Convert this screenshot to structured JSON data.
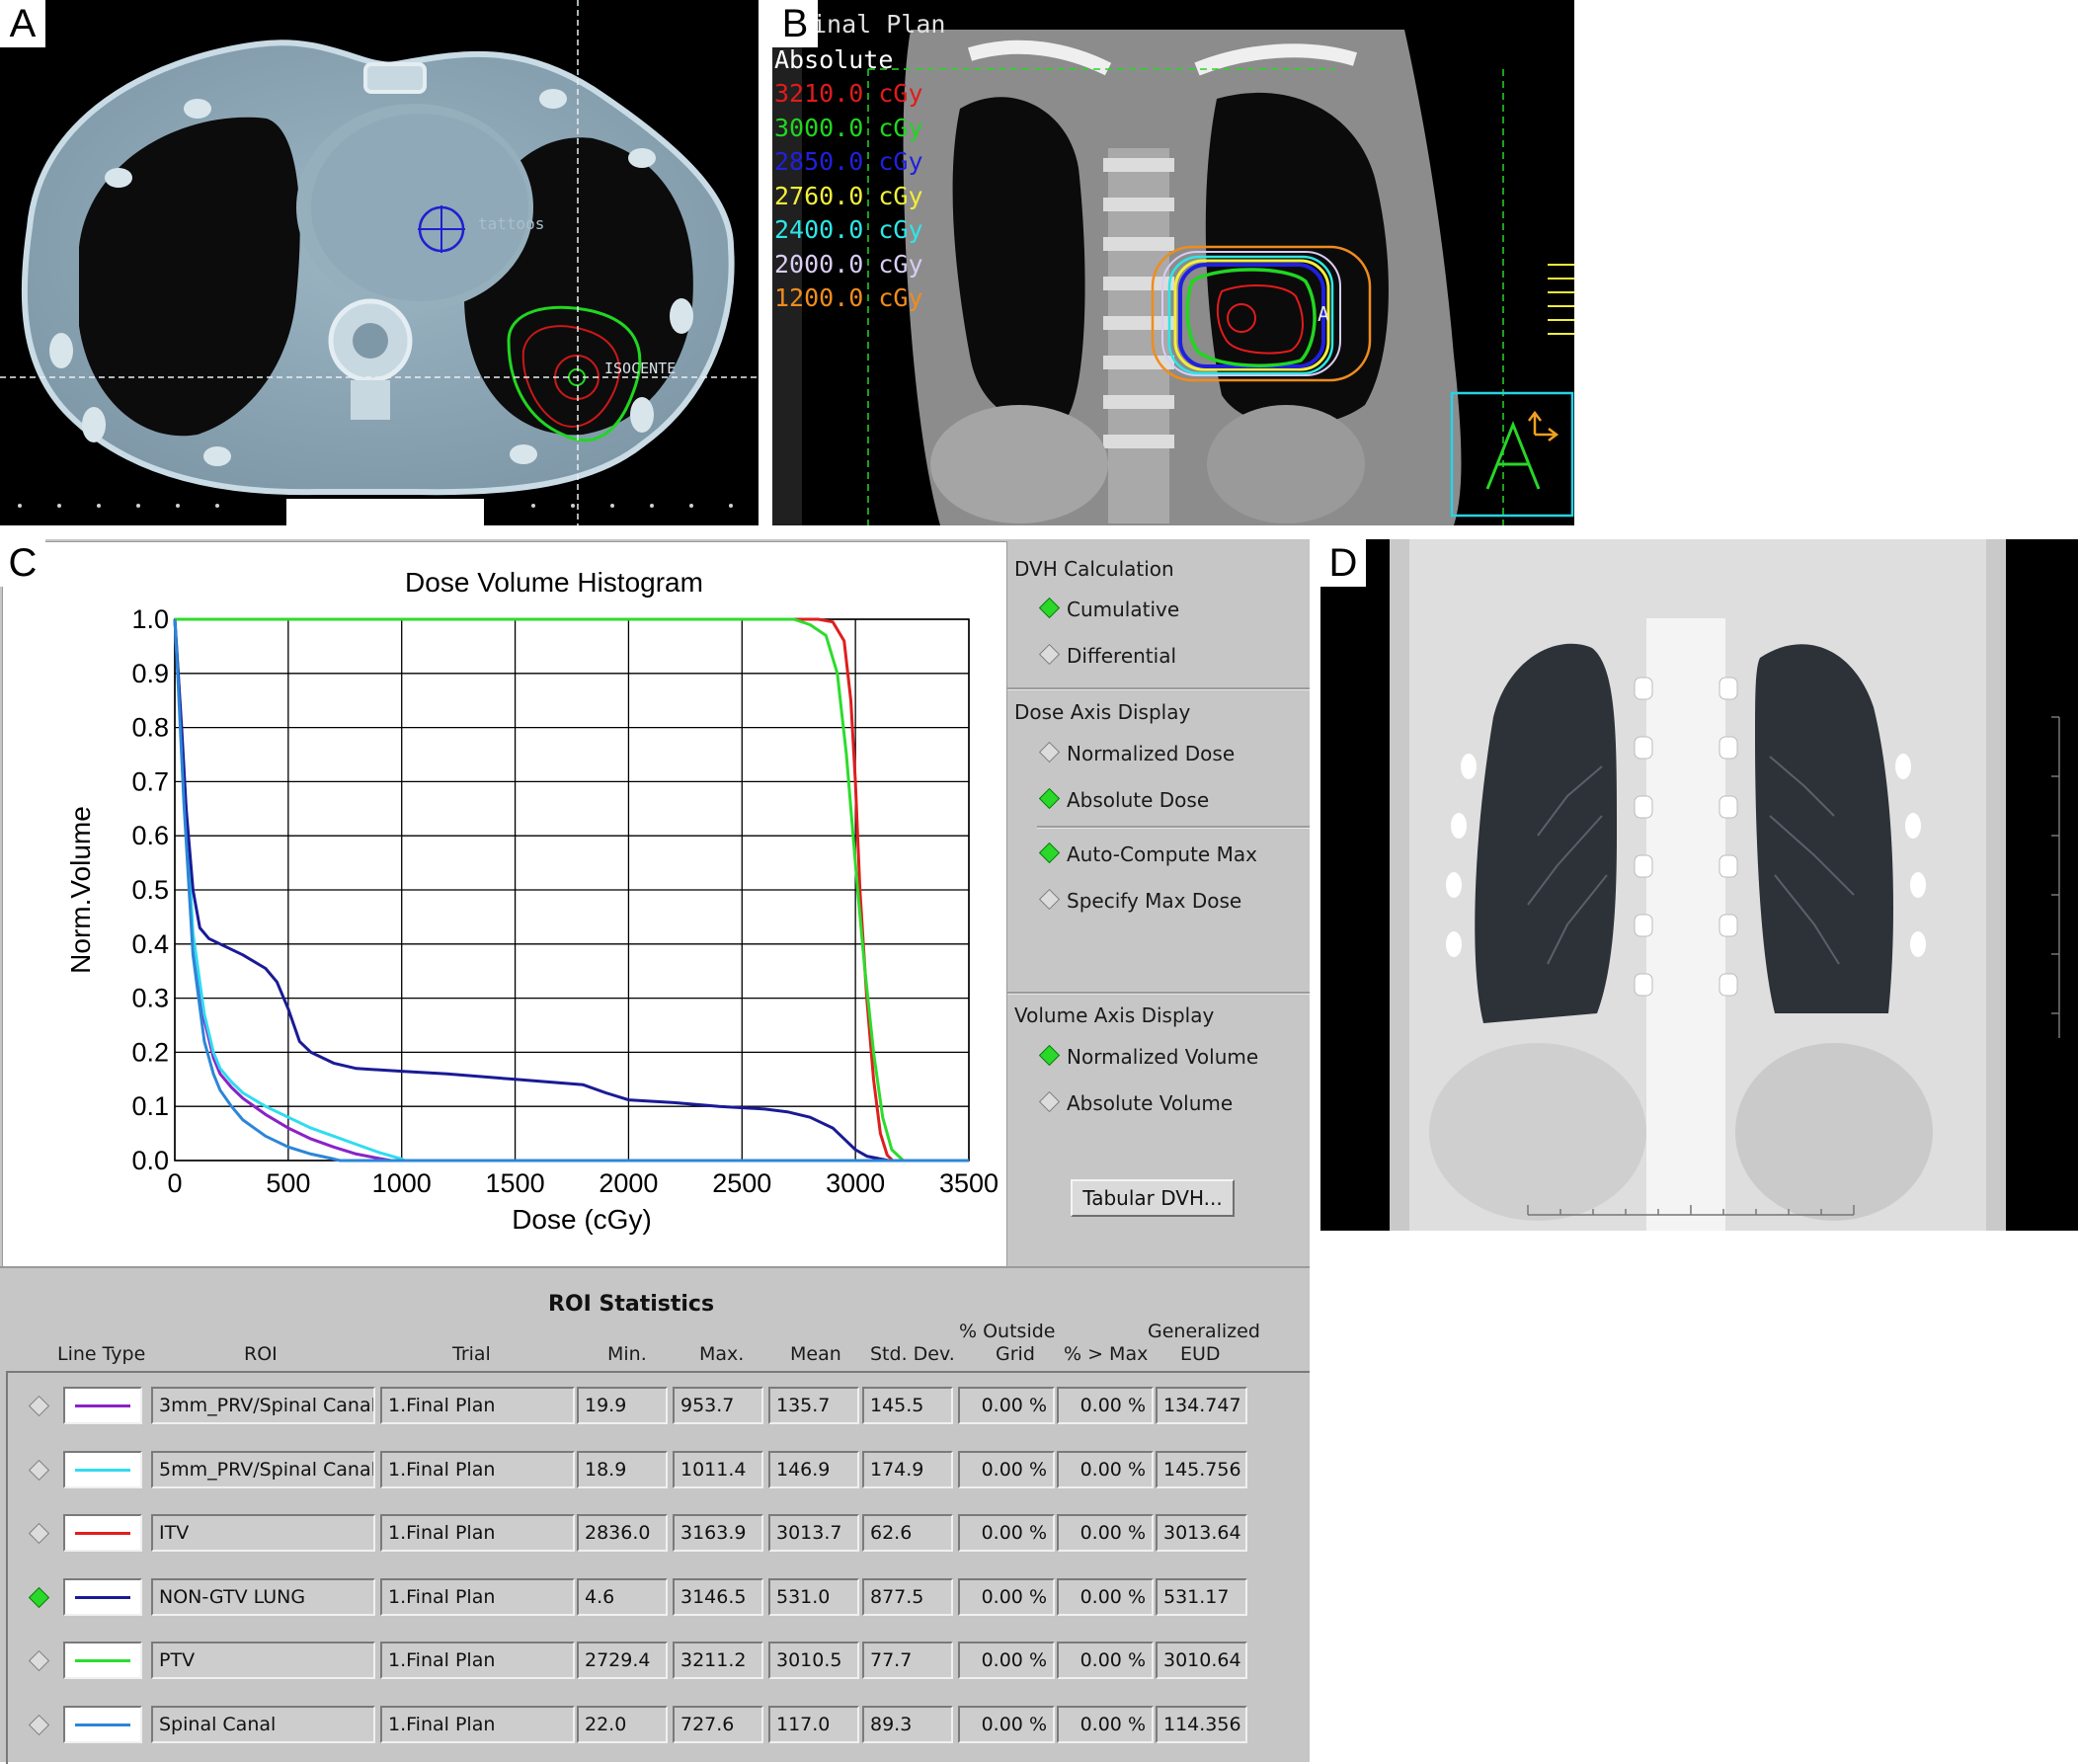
{
  "panels": {
    "a": {
      "letter": "A",
      "tattoos_label": "tattoos",
      "isocenter_label": "ISOCENTE"
    },
    "b": {
      "letter": "B",
      "plan_title": "inal Plan",
      "absolute_label": "Absolute",
      "orientation_label": "A",
      "roi_label": "A",
      "isodose": [
        {
          "label": "3210.0 cGy",
          "color": "#e21b1b"
        },
        {
          "label": "3000.0 cGy",
          "color": "#21d621"
        },
        {
          "label": "2850.0 cGy",
          "color": "#2020e0"
        },
        {
          "label": "2760.0 cGy",
          "color": "#f2ee3a"
        },
        {
          "label": "2400.0 cGy",
          "color": "#2ee6e6"
        },
        {
          "label": "2000.0 cGy",
          "color": "#d9cdf5"
        },
        {
          "label": "1200.0 cGy",
          "color": "#f08c1e"
        }
      ]
    },
    "c": {
      "letter": "C"
    },
    "d": {
      "letter": "D"
    }
  },
  "dvh_options": {
    "calc_heading": "DVH Calculation",
    "cumulative": "Cumulative",
    "differential": "Differential",
    "dose_axis_heading": "Dose Axis Display",
    "normalized_dose": "Normalized Dose",
    "absolute_dose": "Absolute Dose",
    "auto_compute": "Auto-Compute Max",
    "specify_max": "Specify Max Dose",
    "volume_axis_heading": "Volume Axis Display",
    "normalized_volume": "Normalized Volume",
    "absolute_volume": "Absolute Volume",
    "tabular_button": "Tabular DVH..."
  },
  "chart_data": {
    "type": "line",
    "title": "Dose Volume Histogram",
    "xlabel": "Dose (cGy)",
    "ylabel": "Norm.Volume",
    "xlim": [
      0,
      3500
    ],
    "ylim": [
      0,
      1.0
    ],
    "xticks": [
      "0",
      "500",
      "1000",
      "1500",
      "2000",
      "2500",
      "3000",
      "3500"
    ],
    "yticks": [
      "0.0",
      "0.1",
      "0.2",
      "0.3",
      "0.4",
      "0.5",
      "0.6",
      "0.7",
      "0.8",
      "0.9",
      "1.0"
    ],
    "grid": true,
    "series": [
      {
        "name": "3mm_PRV/Spinal Canal",
        "color": "#8a22c8",
        "points": [
          [
            0,
            1.0
          ],
          [
            15,
            0.9
          ],
          [
            40,
            0.7
          ],
          [
            80,
            0.4
          ],
          [
            130,
            0.26
          ],
          [
            170,
            0.19
          ],
          [
            200,
            0.16
          ],
          [
            250,
            0.135
          ],
          [
            300,
            0.115
          ],
          [
            400,
            0.085
          ],
          [
            500,
            0.06
          ],
          [
            600,
            0.04
          ],
          [
            700,
            0.025
          ],
          [
            800,
            0.012
          ],
          [
            900,
            0.004
          ],
          [
            954,
            0.0
          ],
          [
            3500,
            0.0
          ]
        ]
      },
      {
        "name": "5mm_PRV/Spinal Canal",
        "color": "#30dcf0",
        "points": [
          [
            0,
            1.0
          ],
          [
            15,
            0.9
          ],
          [
            40,
            0.72
          ],
          [
            80,
            0.42
          ],
          [
            130,
            0.27
          ],
          [
            170,
            0.2
          ],
          [
            200,
            0.17
          ],
          [
            250,
            0.145
          ],
          [
            300,
            0.125
          ],
          [
            400,
            0.1
          ],
          [
            500,
            0.08
          ],
          [
            600,
            0.06
          ],
          [
            700,
            0.045
          ],
          [
            800,
            0.03
          ],
          [
            900,
            0.015
          ],
          [
            1000,
            0.003
          ],
          [
            1012,
            0.0
          ],
          [
            3500,
            0.0
          ]
        ]
      },
      {
        "name": "ITV",
        "color": "#e01e1e",
        "points": [
          [
            0,
            1.0
          ],
          [
            2836,
            1.0
          ],
          [
            2900,
            0.995
          ],
          [
            2950,
            0.96
          ],
          [
            2980,
            0.85
          ],
          [
            3000,
            0.7
          ],
          [
            3020,
            0.5
          ],
          [
            3050,
            0.3
          ],
          [
            3080,
            0.15
          ],
          [
            3110,
            0.05
          ],
          [
            3140,
            0.01
          ],
          [
            3164,
            0.0
          ],
          [
            3500,
            0.0
          ]
        ]
      },
      {
        "name": "NON-GTV LUNG",
        "color": "#1a1a96",
        "points": [
          [
            0,
            1.0
          ],
          [
            15,
            0.9
          ],
          [
            30,
            0.8
          ],
          [
            50,
            0.65
          ],
          [
            80,
            0.5
          ],
          [
            110,
            0.43
          ],
          [
            150,
            0.41
          ],
          [
            200,
            0.4
          ],
          [
            300,
            0.38
          ],
          [
            400,
            0.355
          ],
          [
            450,
            0.33
          ],
          [
            500,
            0.28
          ],
          [
            550,
            0.22
          ],
          [
            600,
            0.2
          ],
          [
            700,
            0.18
          ],
          [
            800,
            0.17
          ],
          [
            1000,
            0.165
          ],
          [
            1200,
            0.16
          ],
          [
            1500,
            0.15
          ],
          [
            1800,
            0.14
          ],
          [
            1900,
            0.125
          ],
          [
            2000,
            0.112
          ],
          [
            2200,
            0.107
          ],
          [
            2400,
            0.1
          ],
          [
            2600,
            0.095
          ],
          [
            2700,
            0.09
          ],
          [
            2800,
            0.08
          ],
          [
            2900,
            0.06
          ],
          [
            2950,
            0.04
          ],
          [
            3000,
            0.02
          ],
          [
            3050,
            0.008
          ],
          [
            3147,
            0.0
          ],
          [
            3500,
            0.0
          ]
        ]
      },
      {
        "name": "PTV",
        "color": "#2cdc2c",
        "points": [
          [
            0,
            1.0
          ],
          [
            2729,
            1.0
          ],
          [
            2800,
            0.99
          ],
          [
            2870,
            0.97
          ],
          [
            2920,
            0.9
          ],
          [
            2960,
            0.75
          ],
          [
            2990,
            0.6
          ],
          [
            3010,
            0.5
          ],
          [
            3040,
            0.36
          ],
          [
            3080,
            0.2
          ],
          [
            3120,
            0.08
          ],
          [
            3160,
            0.02
          ],
          [
            3211,
            0.0
          ],
          [
            3500,
            0.0
          ]
        ]
      },
      {
        "name": "Spinal Canal",
        "color": "#2b86d8",
        "points": [
          [
            0,
            1.0
          ],
          [
            15,
            0.88
          ],
          [
            40,
            0.66
          ],
          [
            80,
            0.38
          ],
          [
            130,
            0.22
          ],
          [
            170,
            0.16
          ],
          [
            200,
            0.13
          ],
          [
            250,
            0.1
          ],
          [
            300,
            0.075
          ],
          [
            400,
            0.045
          ],
          [
            500,
            0.025
          ],
          [
            600,
            0.012
          ],
          [
            700,
            0.003
          ],
          [
            728,
            0.0
          ],
          [
            3500,
            0.0
          ]
        ]
      }
    ]
  },
  "roi_stats": {
    "title": "ROI Statistics",
    "headers": {
      "line_type": "Line Type",
      "roi": "ROI",
      "trial": "Trial",
      "min": "Min.",
      "max": "Max.",
      "mean": "Mean",
      "std": "Std. Dev.",
      "outside_1": "% Outside",
      "outside_2": "Grid",
      "over_max": "% > Max",
      "eud_1": "Generalized",
      "eud_2": "EUD"
    },
    "rows": [
      {
        "color": "#8a22c8",
        "selected": false,
        "roi": "3mm_PRV/Spinal Canal",
        "trial": "1.Final Plan",
        "min": "19.9",
        "max": "953.7",
        "mean": "135.7",
        "std": "145.5",
        "outside": "0.00 %",
        "over_max": "0.00 %",
        "eud": "134.747"
      },
      {
        "color": "#30dcf0",
        "selected": false,
        "roi": "5mm_PRV/Spinal Canal",
        "trial": "1.Final Plan",
        "min": "18.9",
        "max": "1011.4",
        "mean": "146.9",
        "std": "174.9",
        "outside": "0.00 %",
        "over_max": "0.00 %",
        "eud": "145.756"
      },
      {
        "color": "#e01e1e",
        "selected": false,
        "roi": "ITV",
        "trial": "1.Final Plan",
        "min": "2836.0",
        "max": "3163.9",
        "mean": "3013.7",
        "std": "62.6",
        "outside": "0.00 %",
        "over_max": "0.00 %",
        "eud": "3013.64"
      },
      {
        "color": "#1a1a96",
        "selected": true,
        "roi": "NON-GTV LUNG",
        "trial": "1.Final Plan",
        "min": "4.6",
        "max": "3146.5",
        "mean": "531.0",
        "std": "877.5",
        "outside": "0.00 %",
        "over_max": "0.00 %",
        "eud": "531.17"
      },
      {
        "color": "#2cdc2c",
        "selected": false,
        "roi": "PTV",
        "trial": "1.Final Plan",
        "min": "2729.4",
        "max": "3211.2",
        "mean": "3010.5",
        "std": "77.7",
        "outside": "0.00 %",
        "over_max": "0.00 %",
        "eud": "3010.64"
      },
      {
        "color": "#2b86d8",
        "selected": false,
        "roi": "Spinal Canal",
        "trial": "1.Final Plan",
        "min": "22.0",
        "max": "727.6",
        "mean": "117.0",
        "std": "89.3",
        "outside": "0.00 %",
        "over_max": "0.00 %",
        "eud": "114.356"
      }
    ]
  }
}
